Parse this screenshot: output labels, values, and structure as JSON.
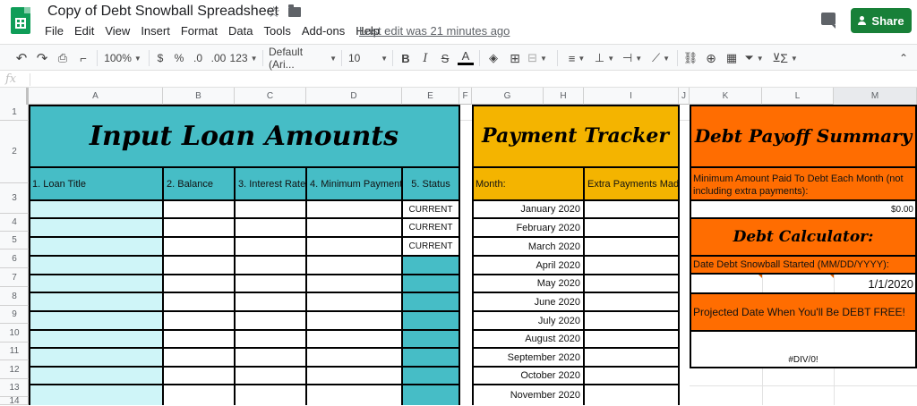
{
  "document": {
    "title": "Copy of Debt Snowball Spreadsheet",
    "last_edit": "Last edit was 21 minutes ago",
    "share_label": "Share"
  },
  "menu": [
    "File",
    "Edit",
    "View",
    "Insert",
    "Format",
    "Data",
    "Tools",
    "Add-ons",
    "Help"
  ],
  "toolbar": {
    "zoom": "100%",
    "currency": "$",
    "percent": "%",
    "dec_decrease": ".0",
    "dec_increase": ".00",
    "more_formats": "123",
    "font": "Default (Ari...",
    "font_size": "10",
    "bold": "B",
    "italic": "I",
    "strike": "S",
    "text_color": "A",
    "sum": "Σ"
  },
  "formula_bar": {
    "fx": "fx"
  },
  "columns": [
    "A",
    "B",
    "C",
    "D",
    "E",
    "F",
    "G",
    "H",
    "I",
    "J",
    "K",
    "L",
    "M"
  ],
  "rows": [
    "1",
    "2",
    "3",
    "4",
    "5",
    "6",
    "7",
    "8",
    "9",
    "10",
    "11",
    "12",
    "13",
    "14"
  ],
  "loan_section": {
    "title": "Input Loan Amounts",
    "headers": [
      "1. Loan Title",
      "2. Balance",
      "3. Interest Rate",
      "4. Minimum Payment",
      "5. Status"
    ],
    "statuses": [
      "CURRENT",
      "CURRENT",
      "CURRENT",
      "",
      "",
      "",
      "",
      "",
      "",
      "",
      ""
    ]
  },
  "payment_tracker": {
    "title": "Payment Tracker",
    "month_header": "Month:",
    "extra_header": "Extra Payments Made",
    "months": [
      "January 2020",
      "February 2020",
      "March 2020",
      "April 2020",
      "May 2020",
      "June 2020",
      "July 2020",
      "August 2020",
      "September 2020",
      "October 2020",
      "November 2020"
    ]
  },
  "summary": {
    "title": "Debt Payoff Summary",
    "min_paid_label": "Minimum Amount Paid To Debt Each Month (not including extra payments):",
    "min_paid_value": "$0.00",
    "calculator_title": "Debt Calculator:",
    "start_label": "Date Debt Snowball Started (MM/DD/YYYY):",
    "start_value": "1/1/2020",
    "projected_label": "Projected Date When You'll Be DEBT FREE!",
    "projected_value": "#DIV/0!"
  },
  "colors": {
    "teal": "#46bdc6",
    "light_teal": "#cff5f8",
    "amber": "#f4b400",
    "orange": "#ff6d01",
    "share_green": "#188038"
  }
}
